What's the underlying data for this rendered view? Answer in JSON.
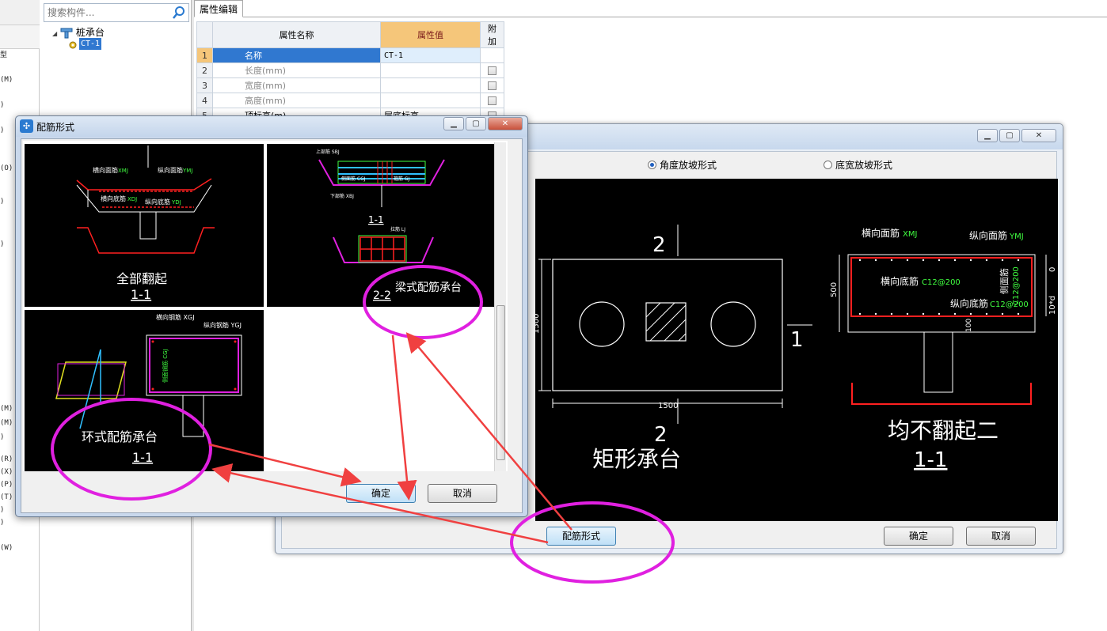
{
  "left_strip": {
    "letters": [
      "型",
      "(M)",
      ")",
      ")",
      "(O)",
      ")",
      ")",
      "(M)",
      "(M)",
      ")",
      "(R)",
      "(X)",
      "(P)",
      "(T)",
      ")",
      ")",
      "(W)"
    ]
  },
  "tree": {
    "search_placeholder": "搜索构件...",
    "root_label": "桩承台",
    "child_label": "CT-1"
  },
  "prop_editor": {
    "tab_label": "属性编辑",
    "headers": {
      "name": "属性名称",
      "value": "属性值",
      "extra": "附加"
    },
    "rows": [
      {
        "num": "1",
        "name": "名称",
        "value": "CT-1"
      },
      {
        "num": "2",
        "name": "长度(mm)",
        "value": ""
      },
      {
        "num": "3",
        "name": "宽度(mm)",
        "value": ""
      },
      {
        "num": "4",
        "name": "高度(mm)",
        "value": ""
      },
      {
        "num": "5",
        "name": "顶标高(m)",
        "value": "层底标高"
      }
    ]
  },
  "big_window": {
    "radio_angle": "角度放坡形式",
    "radio_bottom": "底宽放坡形式",
    "plan": {
      "section_top": "2",
      "section_bottom": "2",
      "section_right": "1",
      "dim_height": "1500",
      "dim_width": "1500",
      "title": "矩形承台"
    },
    "section": {
      "top_bar_label": "横向面筋",
      "top_bar_code": "XMJ",
      "top_long_label": "纵向面筋",
      "top_long_code": "YMJ",
      "bottom_label": "横向底筋",
      "bottom_code": "C12@200",
      "long_bottom_label": "纵向底筋",
      "long_bottom_code": "C12@200",
      "side_label": "侧面筋",
      "side_code": "C12@200",
      "dim_height": "500",
      "dim_zero": "0",
      "dim_anchor": "10*d",
      "dim_100": "100",
      "title": "均不翻起二",
      "subtitle": "1-1"
    },
    "rebar_button": "配筋形式",
    "ok": "确定",
    "cancel": "取消"
  },
  "small_window": {
    "title": "配筋形式",
    "thumbs": {
      "t1_title": "全部翻起",
      "t1_sub": "1-1",
      "t1_labels": [
        "横向面筋",
        "纵向面筋",
        "横向底筋",
        "纵向底筋"
      ],
      "t1_codes": [
        "XMJ",
        "YMJ",
        "XDJ",
        "YDJ"
      ],
      "t2_sub_top": "1-1",
      "t2_sub": "2-2",
      "t2_label": "梁式配筋承台",
      "t2_codes": [
        "上部筋 SBJ",
        "下部筋 XBJ",
        "侧面筋 CGJ",
        "箍筋 GJ",
        "拉筋 LJ"
      ],
      "t3_label": "环式配筋承台",
      "t3_sub": "1-1",
      "t3_codes": [
        "横向钢筋 XGJ",
        "纵向钢筋 YGJ",
        "侧面钢筋 CGJ"
      ]
    },
    "ok": "确定",
    "cancel": "取消"
  },
  "colors": {
    "accent_magenta": "#e020e0",
    "arrow_red": "#f04040",
    "selection_blue": "#3078d0",
    "header_orange": "#f5c67a"
  }
}
